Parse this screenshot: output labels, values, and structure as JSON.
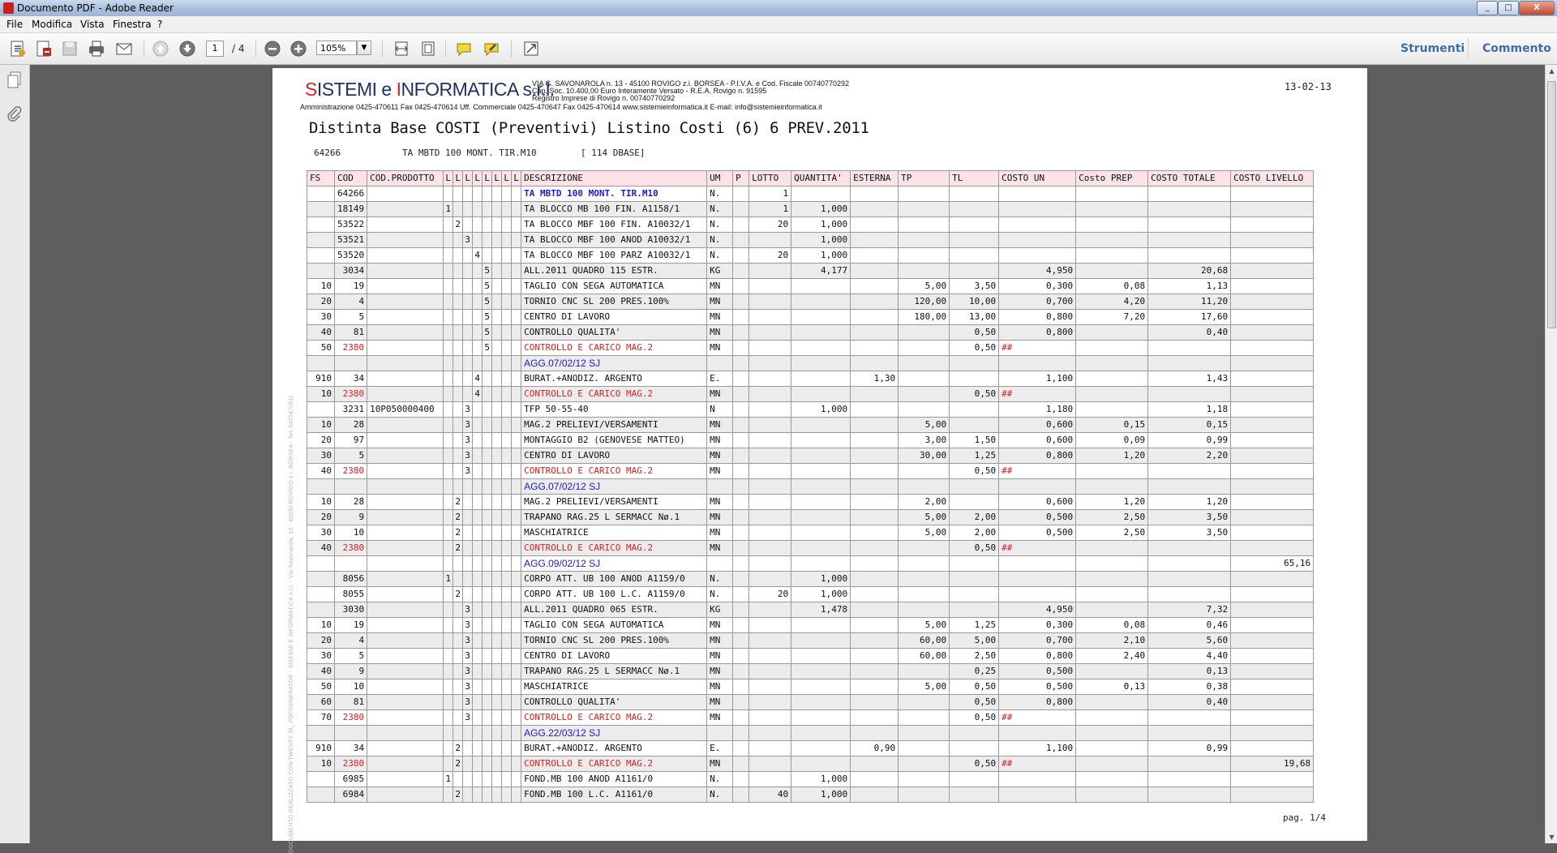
{
  "window": {
    "title": "Documento PDF - Adobe Reader",
    "min": "_",
    "max": "□",
    "close": "X"
  },
  "menu": [
    "File",
    "Modifica",
    "Vista",
    "Finestra",
    "?"
  ],
  "toolbar": {
    "page_current": "1",
    "page_total": "/ 4",
    "zoom": "105%",
    "tools": "Strumenti",
    "comment": "Commento"
  },
  "doc": {
    "logo_part1": "S",
    "logo_part2": "ISTEMI e ",
    "logo_part3": "I",
    "logo_part4": "NFORMATICA",
    "logo_part5": " s.r.l.",
    "company_lines": [
      "VIA G. SAVONAROLA n. 13 - 45100 ROVIGO z.i. BORSEA - P.I.V.A. e Cod. Fiscale 00740770292",
      "Cap. Soc. 10.400,00 Euro Interamente Versato - R.E.A. Rovigo n. 91595",
      "Registro Imprese di Rovigo n. 00740770292"
    ],
    "company_contacts": "Amministrazione 0425-470611 Fax 0425-470614 Uff. Commerciale 0425-470647 Fax 0425-470614 www.sistemieinformatica.it E-mail: info@sistemieinformatica.it",
    "date": "13-02-13",
    "title": "Distinta Base COSTI (Preventivi)  Listino Costi (6) 6 PREV.2011",
    "sub_code": "64266",
    "sub_desc": "TA MBTD 100 MONT. TIR.M10",
    "sub_base": "[ 114 DBASE]",
    "page_footer": "pag. 1/4",
    "side_text": "DOCUMENTO REALIZZATO CON TWENTY DL_PDFGENERATOR - SISTEMI E INFORMATICA s.r.l. - Via Savonarola, 13 - 45030 ROVIGO z.i. BORSEA - Tel. 0425470611"
  },
  "table": {
    "headers": [
      "FS",
      "COD",
      "COD.PRODOTTO",
      "L",
      "L",
      "L",
      "L",
      "L",
      "L",
      "L",
      "L",
      "DESCRIZIONE",
      "UM",
      "P",
      "LOTTO",
      "QUANTITA'",
      "ESTERNA",
      "TP",
      "TL",
      "COSTO UN",
      "Costo PREP",
      "COSTO TOTALE",
      "COSTO LIVELLO"
    ],
    "rows": [
      {
        "fs": "",
        "cod": "64266",
        "prod": "",
        "lvl": 0,
        "lv": "",
        "desc": "TA MBTD 100 MONT. TIR.M10",
        "descStyle": "boldblue",
        "um": "N.",
        "p": "",
        "lotto": "1",
        "qta": "",
        "est": "",
        "tp": "",
        "tl": "",
        "cun": "",
        "cprep": "",
        "ctot": "",
        "cliv": ""
      },
      {
        "fs": "",
        "cod": "18149",
        "prod": "",
        "lvl": 1,
        "lv": "1",
        "desc": "TA BLOCCO MB 100 FIN.     A1158/1",
        "um": "N.",
        "p": "",
        "lotto": "1",
        "qta": "1,000",
        "est": "",
        "tp": "",
        "tl": "",
        "cun": "",
        "cprep": "",
        "ctot": "",
        "cliv": ""
      },
      {
        "fs": "",
        "cod": "53522",
        "prod": "",
        "lvl": 2,
        "lv": "2",
        "desc": "TA BLOCCO MBF 100 FIN.   A10032/1",
        "um": "N.",
        "p": "",
        "lotto": "20",
        "qta": "1,000",
        "est": "",
        "tp": "",
        "tl": "",
        "cun": "",
        "cprep": "",
        "ctot": "",
        "cliv": ""
      },
      {
        "fs": "",
        "cod": "53521",
        "prod": "",
        "lvl": 3,
        "lv": "3",
        "desc": "TA BLOCCO MBF 100 ANOD   A10032/1",
        "um": "N.",
        "p": "",
        "lotto": "",
        "qta": "1,000",
        "est": "",
        "tp": "",
        "tl": "",
        "cun": "",
        "cprep": "",
        "ctot": "",
        "cliv": ""
      },
      {
        "fs": "",
        "cod": "53520",
        "prod": "",
        "lvl": 4,
        "lv": "4",
        "desc": "TA BLOCCO MBF 100 PARZ   A10032/1",
        "um": "N.",
        "p": "",
        "lotto": "20",
        "qta": "1,000",
        "est": "",
        "tp": "",
        "tl": "",
        "cun": "",
        "cprep": "",
        "ctot": "",
        "cliv": ""
      },
      {
        "fs": "",
        "cod": "3034",
        "prod": "",
        "lvl": 5,
        "lv": "5",
        "desc": "ALL.2011 QUADRO 115 ESTR.",
        "um": "KG",
        "p": "",
        "lotto": "",
        "qta": "4,177",
        "est": "",
        "tp": "",
        "tl": "",
        "cun": "4,950",
        "cprep": "",
        "ctot": "20,68",
        "cliv": ""
      },
      {
        "fs": "10",
        "cod": "19",
        "prod": "",
        "lvl": 5,
        "lv": "5",
        "desc": "TAGLIO CON SEGA AUTOMATICA",
        "um": "MN",
        "p": "",
        "lotto": "",
        "qta": "",
        "est": "",
        "tp": "5,00",
        "tl": "3,50",
        "cun": "0,300",
        "cprep": "0,08",
        "ctot": "1,13",
        "cliv": ""
      },
      {
        "fs": "20",
        "cod": "4",
        "prod": "",
        "lvl": 5,
        "lv": "5",
        "desc": "TORNIO CNC SL 200 PRES.100%",
        "um": "MN",
        "p": "",
        "lotto": "",
        "qta": "",
        "est": "",
        "tp": "120,00",
        "tl": "10,00",
        "cun": "0,700",
        "cprep": "4,20",
        "ctot": "11,20",
        "cliv": ""
      },
      {
        "fs": "30",
        "cod": "5",
        "prod": "",
        "lvl": 5,
        "lv": "5",
        "desc": "CENTRO DI LAVORO",
        "um": "MN",
        "p": "",
        "lotto": "",
        "qta": "",
        "est": "",
        "tp": "180,00",
        "tl": "13,00",
        "cun": "0,800",
        "cprep": "7,20",
        "ctot": "17,60",
        "cliv": ""
      },
      {
        "fs": "40",
        "cod": "81",
        "prod": "",
        "lvl": 5,
        "lv": "5",
        "desc": "CONTROLLO QUALITA'",
        "um": "MN",
        "p": "",
        "lotto": "",
        "qta": "",
        "est": "",
        "tp": "",
        "tl": "0,50",
        "cun": "0,800",
        "cprep": "",
        "ctot": "0,40",
        "cliv": ""
      },
      {
        "fs": "50",
        "cod": "2380",
        "codStyle": "red",
        "prod": "",
        "lvl": 5,
        "lv": "5",
        "desc": "CONTROLLO E CARICO MAG.2",
        "descStyle": "red",
        "um": "MN",
        "p": "",
        "lotto": "",
        "qta": "",
        "est": "",
        "tp": "",
        "tl": "0,50",
        "cun": "##",
        "cunStyle": "red",
        "cprep": "",
        "ctot": "",
        "cliv": ""
      },
      {
        "fs": "",
        "cod": "",
        "prod": "",
        "lvl": 0,
        "lv": "",
        "desc": "AGG.07/02/12 SJ",
        "descStyle": "agg",
        "um": "",
        "p": "",
        "lotto": "",
        "qta": "",
        "est": "",
        "tp": "",
        "tl": "",
        "cun": "",
        "cprep": "",
        "ctot": "",
        "cliv": ""
      },
      {
        "fs": "910",
        "cod": "34",
        "prod": "",
        "lvl": 4,
        "lv": "4",
        "desc": "BURAT.+ANODIZ. ARGENTO",
        "um": "E.",
        "p": "",
        "lotto": "",
        "qta": "",
        "est": "1,30",
        "tp": "",
        "tl": "",
        "cun": "1,100",
        "cprep": "",
        "ctot": "1,43",
        "cliv": ""
      },
      {
        "fs": "10",
        "cod": "2380",
        "codStyle": "red",
        "prod": "",
        "lvl": 4,
        "lv": "4",
        "desc": "CONTROLLO E CARICO MAG.2",
        "descStyle": "red",
        "um": "MN",
        "p": "",
        "lotto": "",
        "qta": "",
        "est": "",
        "tp": "",
        "tl": "0,50",
        "cun": "##",
        "cunStyle": "red",
        "cprep": "",
        "ctot": "",
        "cliv": ""
      },
      {
        "fs": "",
        "cod": "3231",
        "prod": "10P050000400",
        "lvl": 3,
        "lv": "3",
        "desc": "TFP 50-55-40",
        "um": "N",
        "p": "",
        "lotto": "",
        "qta": "1,000",
        "est": "",
        "tp": "",
        "tl": "",
        "cun": "1,180",
        "cprep": "",
        "ctot": "1,18",
        "cliv": ""
      },
      {
        "fs": "10",
        "cod": "28",
        "prod": "",
        "lvl": 3,
        "lv": "3",
        "desc": "MAG.2 PRELIEVI/VERSAMENTI",
        "um": "MN",
        "p": "",
        "lotto": "",
        "qta": "",
        "est": "",
        "tp": "5,00",
        "tl": "",
        "cun": "0,600",
        "cprep": "0,15",
        "ctot": "0,15",
        "cliv": ""
      },
      {
        "fs": "20",
        "cod": "97",
        "prod": "",
        "lvl": 3,
        "lv": "3",
        "desc": "MONTAGGIO B2 (GENOVESE MATTEO)",
        "um": "MN",
        "p": "",
        "lotto": "",
        "qta": "",
        "est": "",
        "tp": "3,00",
        "tl": "1,50",
        "cun": "0,600",
        "cprep": "0,09",
        "ctot": "0,99",
        "cliv": ""
      },
      {
        "fs": "30",
        "cod": "5",
        "prod": "",
        "lvl": 3,
        "lv": "3",
        "desc": "CENTRO DI LAVORO",
        "um": "MN",
        "p": "",
        "lotto": "",
        "qta": "",
        "est": "",
        "tp": "30,00",
        "tl": "1,25",
        "cun": "0,800",
        "cprep": "1,20",
        "ctot": "2,20",
        "cliv": ""
      },
      {
        "fs": "40",
        "cod": "2380",
        "codStyle": "red",
        "prod": "",
        "lvl": 3,
        "lv": "3",
        "desc": "CONTROLLO E CARICO MAG.2",
        "descStyle": "red",
        "um": "MN",
        "p": "",
        "lotto": "",
        "qta": "",
        "est": "",
        "tp": "",
        "tl": "0,50",
        "cun": "##",
        "cunStyle": "red",
        "cprep": "",
        "ctot": "",
        "cliv": ""
      },
      {
        "fs": "",
        "cod": "",
        "prod": "",
        "lvl": 0,
        "lv": "",
        "desc": "AGG.07/02/12 SJ",
        "descStyle": "agg",
        "um": "",
        "p": "",
        "lotto": "",
        "qta": "",
        "est": "",
        "tp": "",
        "tl": "",
        "cun": "",
        "cprep": "",
        "ctot": "",
        "cliv": ""
      },
      {
        "fs": "10",
        "cod": "28",
        "prod": "",
        "lvl": 2,
        "lv": "2",
        "desc": "MAG.2 PRELIEVI/VERSAMENTI",
        "um": "MN",
        "p": "",
        "lotto": "",
        "qta": "",
        "est": "",
        "tp": "2,00",
        "tl": "",
        "cun": "0,600",
        "cprep": "1,20",
        "ctot": "1,20",
        "cliv": ""
      },
      {
        "fs": "20",
        "cod": "9",
        "prod": "",
        "lvl": 2,
        "lv": "2",
        "desc": "TRAPANO RAG.25 L SERMACC Nø.1",
        "um": "MN",
        "p": "",
        "lotto": "",
        "qta": "",
        "est": "",
        "tp": "5,00",
        "tl": "2,00",
        "cun": "0,500",
        "cprep": "2,50",
        "ctot": "3,50",
        "cliv": ""
      },
      {
        "fs": "30",
        "cod": "10",
        "prod": "",
        "lvl": 2,
        "lv": "2",
        "desc": "MASCHIATRICE",
        "um": "MN",
        "p": "",
        "lotto": "",
        "qta": "",
        "est": "",
        "tp": "5,00",
        "tl": "2,00",
        "cun": "0,500",
        "cprep": "2,50",
        "ctot": "3,50",
        "cliv": ""
      },
      {
        "fs": "40",
        "cod": "2380",
        "codStyle": "red",
        "prod": "",
        "lvl": 2,
        "lv": "2",
        "desc": "CONTROLLO E CARICO MAG.2",
        "descStyle": "red",
        "um": "MN",
        "p": "",
        "lotto": "",
        "qta": "",
        "est": "",
        "tp": "",
        "tl": "0,50",
        "cun": "##",
        "cunStyle": "red",
        "cprep": "",
        "ctot": "",
        "cliv": ""
      },
      {
        "fs": "",
        "cod": "",
        "prod": "",
        "lvl": 0,
        "lv": "",
        "desc": "AGG.09/02/12 SJ",
        "descStyle": "agg",
        "um": "",
        "p": "",
        "lotto": "",
        "qta": "",
        "est": "",
        "tp": "",
        "tl": "",
        "cun": "",
        "cprep": "",
        "ctot": "",
        "cliv": "65,16"
      },
      {
        "fs": "",
        "cod": "8056",
        "prod": "",
        "lvl": 1,
        "lv": "1",
        "desc": "CORPO ATT. UB 100 ANOD    A1159/0",
        "um": "N.",
        "p": "",
        "lotto": "",
        "qta": "1,000",
        "est": "",
        "tp": "",
        "tl": "",
        "cun": "",
        "cprep": "",
        "ctot": "",
        "cliv": ""
      },
      {
        "fs": "",
        "cod": "8055",
        "prod": "",
        "lvl": 2,
        "lv": "2",
        "desc": "CORPO ATT. UB 100 L.C.    A1159/0",
        "um": "N.",
        "p": "",
        "lotto": "20",
        "qta": "1,000",
        "est": "",
        "tp": "",
        "tl": "",
        "cun": "",
        "cprep": "",
        "ctot": "",
        "cliv": ""
      },
      {
        "fs": "",
        "cod": "3030",
        "prod": "",
        "lvl": 3,
        "lv": "3",
        "desc": "ALL.2011 QUADRO 065 ESTR.",
        "um": "KG",
        "p": "",
        "lotto": "",
        "qta": "1,478",
        "est": "",
        "tp": "",
        "tl": "",
        "cun": "4,950",
        "cprep": "",
        "ctot": "7,32",
        "cliv": ""
      },
      {
        "fs": "10",
        "cod": "19",
        "prod": "",
        "lvl": 3,
        "lv": "3",
        "desc": "TAGLIO CON SEGA AUTOMATICA",
        "um": "MN",
        "p": "",
        "lotto": "",
        "qta": "",
        "est": "",
        "tp": "5,00",
        "tl": "1,25",
        "cun": "0,300",
        "cprep": "0,08",
        "ctot": "0,46",
        "cliv": ""
      },
      {
        "fs": "20",
        "cod": "4",
        "prod": "",
        "lvl": 3,
        "lv": "3",
        "desc": "TORNIO CNC SL 200 PRES.100%",
        "um": "MN",
        "p": "",
        "lotto": "",
        "qta": "",
        "est": "",
        "tp": "60,00",
        "tl": "5,00",
        "cun": "0,700",
        "cprep": "2,10",
        "ctot": "5,60",
        "cliv": ""
      },
      {
        "fs": "30",
        "cod": "5",
        "prod": "",
        "lvl": 3,
        "lv": "3",
        "desc": "CENTRO DI LAVORO",
        "um": "MN",
        "p": "",
        "lotto": "",
        "qta": "",
        "est": "",
        "tp": "60,00",
        "tl": "2,50",
        "cun": "0,800",
        "cprep": "2,40",
        "ctot": "4,40",
        "cliv": ""
      },
      {
        "fs": "40",
        "cod": "9",
        "prod": "",
        "lvl": 3,
        "lv": "3",
        "desc": "TRAPANO RAG.25 L SERMACC Nø.1",
        "um": "MN",
        "p": "",
        "lotto": "",
        "qta": "",
        "est": "",
        "tp": "",
        "tl": "0,25",
        "cun": "0,500",
        "cprep": "",
        "ctot": "0,13",
        "cliv": ""
      },
      {
        "fs": "50",
        "cod": "10",
        "prod": "",
        "lvl": 3,
        "lv": "3",
        "desc": "MASCHIATRICE",
        "um": "MN",
        "p": "",
        "lotto": "",
        "qta": "",
        "est": "",
        "tp": "5,00",
        "tl": "0,50",
        "cun": "0,500",
        "cprep": "0,13",
        "ctot": "0,38",
        "cliv": ""
      },
      {
        "fs": "60",
        "cod": "81",
        "prod": "",
        "lvl": 3,
        "lv": "3",
        "desc": "CONTROLLO QUALITA'",
        "um": "MN",
        "p": "",
        "lotto": "",
        "qta": "",
        "est": "",
        "tp": "",
        "tl": "0,50",
        "cun": "0,800",
        "cprep": "",
        "ctot": "0,40",
        "cliv": ""
      },
      {
        "fs": "70",
        "cod": "2380",
        "codStyle": "red",
        "prod": "",
        "lvl": 3,
        "lv": "3",
        "desc": "CONTROLLO E CARICO MAG.2",
        "descStyle": "red",
        "um": "MN",
        "p": "",
        "lotto": "",
        "qta": "",
        "est": "",
        "tp": "",
        "tl": "0,50",
        "cun": "##",
        "cunStyle": "red",
        "cprep": "",
        "ctot": "",
        "cliv": ""
      },
      {
        "fs": "",
        "cod": "",
        "prod": "",
        "lvl": 0,
        "lv": "",
        "desc": "AGG.22/03/12 SJ",
        "descStyle": "agg",
        "um": "",
        "p": "",
        "lotto": "",
        "qta": "",
        "est": "",
        "tp": "",
        "tl": "",
        "cun": "",
        "cprep": "",
        "ctot": "",
        "cliv": ""
      },
      {
        "fs": "910",
        "cod": "34",
        "prod": "",
        "lvl": 2,
        "lv": "2",
        "desc": "BURAT.+ANODIZ. ARGENTO",
        "um": "E.",
        "p": "",
        "lotto": "",
        "qta": "",
        "est": "0,90",
        "tp": "",
        "tl": "",
        "cun": "1,100",
        "cprep": "",
        "ctot": "0,99",
        "cliv": ""
      },
      {
        "fs": "10",
        "cod": "2380",
        "codStyle": "red",
        "prod": "",
        "lvl": 2,
        "lv": "2",
        "desc": "CONTROLLO E CARICO MAG.2",
        "descStyle": "red",
        "um": "MN",
        "p": "",
        "lotto": "",
        "qta": "",
        "est": "",
        "tp": "",
        "tl": "0,50",
        "cun": "##",
        "cunStyle": "red",
        "cprep": "",
        "ctot": "",
        "cliv": "19,68"
      },
      {
        "fs": "",
        "cod": "6985",
        "prod": "",
        "lvl": 1,
        "lv": "1",
        "desc": "FOND.MB 100 ANOD          A1161/0",
        "um": "N.",
        "p": "",
        "lotto": "",
        "qta": "1,000",
        "est": "",
        "tp": "",
        "tl": "",
        "cun": "",
        "cprep": "",
        "ctot": "",
        "cliv": ""
      },
      {
        "fs": "",
        "cod": "6984",
        "prod": "",
        "lvl": 2,
        "lv": "2",
        "desc": "FOND.MB 100 L.C.          A1161/0",
        "um": "N.",
        "p": "",
        "lotto": "40",
        "qta": "1,000",
        "est": "",
        "tp": "",
        "tl": "",
        "cun": "",
        "cprep": "",
        "ctot": "",
        "cliv": ""
      }
    ]
  }
}
